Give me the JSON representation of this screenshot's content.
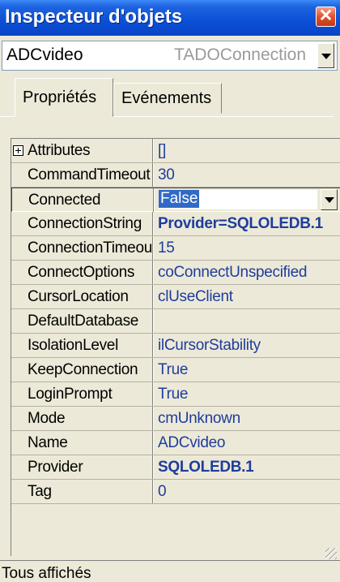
{
  "window": {
    "title": "Inspecteur d'objets",
    "close_glyph": "✕"
  },
  "object_selector": {
    "name": "ADCvideo",
    "type": "TADOConnection"
  },
  "tabs": [
    {
      "label": "Propriétés",
      "active": true
    },
    {
      "label": "Evénements",
      "active": false
    }
  ],
  "properties": [
    {
      "name": "Attributes",
      "value": "[]",
      "expandable": true,
      "bold": false
    },
    {
      "name": "CommandTimeout",
      "value": "30",
      "bold": false
    },
    {
      "name": "Connected",
      "value": "False",
      "selected": true,
      "bold": false
    },
    {
      "name": "ConnectionString",
      "value": "Provider=SQLOLEDB.1",
      "bold": true
    },
    {
      "name": "ConnectionTimeout",
      "value": "15",
      "bold": false
    },
    {
      "name": "ConnectOptions",
      "value": "coConnectUnspecified",
      "bold": false
    },
    {
      "name": "CursorLocation",
      "value": "clUseClient",
      "bold": false
    },
    {
      "name": "DefaultDatabase",
      "value": "",
      "bold": false
    },
    {
      "name": "IsolationLevel",
      "value": "ilCursorStability",
      "bold": false
    },
    {
      "name": "KeepConnection",
      "value": "True",
      "bold": false
    },
    {
      "name": "LoginPrompt",
      "value": "True",
      "bold": false
    },
    {
      "name": "Mode",
      "value": "cmUnknown",
      "bold": false
    },
    {
      "name": "Name",
      "value": "ADCvideo",
      "bold": false
    },
    {
      "name": "Provider",
      "value": "SQLOLEDB.1",
      "bold": true
    },
    {
      "name": "Tag",
      "value": "0",
      "bold": false
    }
  ],
  "status": {
    "text": "Tous affichés"
  },
  "colors": {
    "titlebar": "#0a4fd6",
    "value_text": "#1e3d9c",
    "selection": "#316ac5"
  }
}
